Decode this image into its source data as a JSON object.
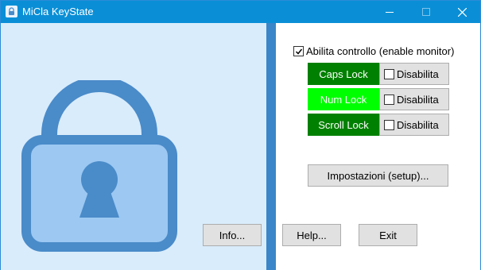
{
  "window": {
    "title": "MiCla KeyState",
    "colors": {
      "titlebar": "#0a8fd6",
      "divider": "#3a86c8",
      "lock": "#4a8bc9",
      "lock_body": "#9cc8f2"
    },
    "controls": {
      "minimize_icon": "minimize-icon",
      "maximize_icon": "maximize-icon",
      "close_icon": "close-icon"
    }
  },
  "left": {
    "info_label": "Info..."
  },
  "right": {
    "enable_monitor": {
      "label": "Abilita controllo (enable monitor)",
      "checked": true
    },
    "keys": [
      {
        "name": "Caps Lock",
        "bg": "#008000",
        "fg": "#ffffff",
        "disable_label": "Disabilita",
        "disabled": false
      },
      {
        "name": "Num Lock",
        "bg": "#00ff00",
        "fg": "#ffffff",
        "disable_label": "Disabilita",
        "disabled": false
      },
      {
        "name": "Scroll Lock",
        "bg": "#008000",
        "fg": "#ffffff",
        "disable_label": "Disabilita",
        "disabled": false
      }
    ],
    "setup_label": "Impostazioni (setup)...",
    "help_label": "Help...",
    "exit_label": "Exit"
  }
}
